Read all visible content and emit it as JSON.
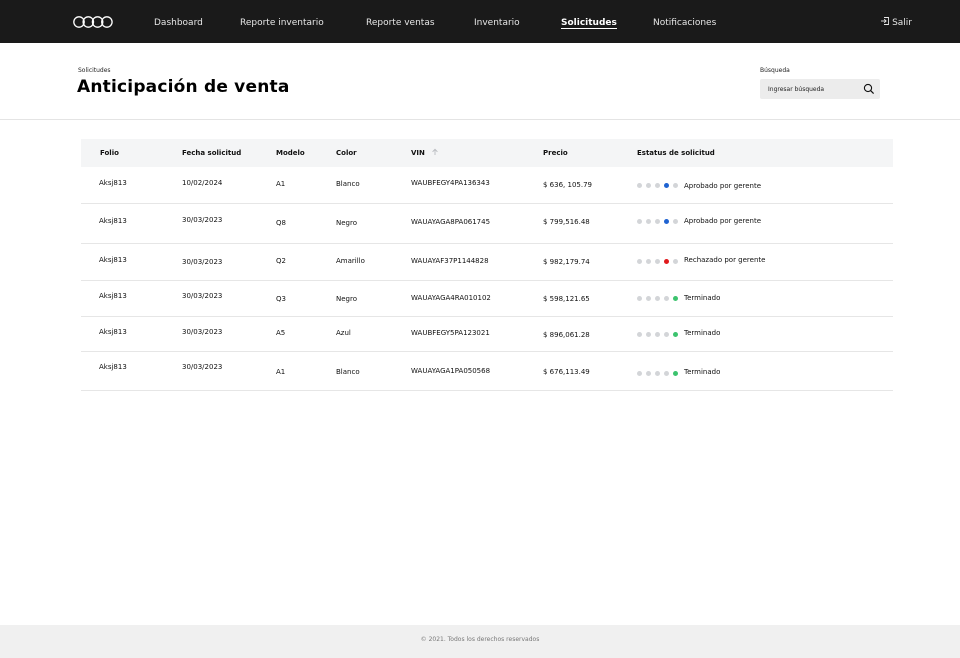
{
  "nav": {
    "items": [
      {
        "label": "Dashboard"
      },
      {
        "label": "Reporte inventario"
      },
      {
        "label": "Reporte ventas"
      },
      {
        "label": "Inventario"
      },
      {
        "label": "Solicitudes"
      },
      {
        "label": "Notificaciones"
      }
    ],
    "active": "Solicitudes",
    "logout_label": "Salir"
  },
  "header": {
    "breadcrumb": "Solicitudes",
    "title": "Anticipación de venta",
    "search_label": "Búsqueda",
    "search_placeholder": "Ingresar búsqueda"
  },
  "table": {
    "columns": [
      "Folio",
      "Fecha solicitud",
      "Modelo",
      "Color",
      "VIN",
      "Precio",
      "Estatus de solicitud"
    ],
    "sorted_column": "VIN",
    "rows": [
      {
        "folio": "Aksj813",
        "fecha": "10/02/2024",
        "modelo": "A1",
        "color": "Blanco",
        "vin": "WAUBFEGY4PA136343",
        "precio": "$ 636, 105.79",
        "estatus": "Aprobado por gerente",
        "step": 4,
        "status_color": "#1f63d1"
      },
      {
        "folio": "Aksj813",
        "fecha": "30/03/2023",
        "modelo": "Q8",
        "color": "Negro",
        "vin": "WAUAYAGA8PA061745",
        "precio": "$ 799,516.48",
        "estatus": "Aprobado por gerente",
        "step": 4,
        "status_color": "#1f63d1"
      },
      {
        "folio": "Aksj813",
        "fecha": "30/03/2023",
        "modelo": "Q2",
        "color": "Amarillo",
        "vin": "WAUAYAF37P1144828",
        "precio": "$ 982,179.74",
        "estatus": "Rechazado por gerente",
        "step": 4,
        "status_color": "#e0191c"
      },
      {
        "folio": "Aksj813",
        "fecha": "30/03/2023",
        "modelo": "Q3",
        "color": "Negro",
        "vin": "WAUAYAGA4RA010102",
        "precio": "$ 598,121.65",
        "estatus": "Terminado",
        "step": 5,
        "status_color": "#3cc36e"
      },
      {
        "folio": "Aksj813",
        "fecha": "30/03/2023",
        "modelo": "A5",
        "color": "Azul",
        "vin": "WAUBFEGY5PA123021",
        "precio": "$ 896,061.28",
        "estatus": "Terminado",
        "step": 5,
        "status_color": "#3cc36e"
      },
      {
        "folio": "Aksj813",
        "fecha": "30/03/2023",
        "modelo": "A1",
        "color": "Blanco",
        "vin": "WAUAYAGA1PA050568",
        "precio": "$ 676,113.49",
        "estatus": "Terminado",
        "step": 5,
        "status_color": "#3cc36e"
      }
    ]
  },
  "colors": {
    "topbar": "#1a1a1a",
    "dot_inactive": "#d3d5d8"
  },
  "icons": {
    "logo": "four-rings-logo-icon",
    "logout": "logout-icon",
    "search": "search-icon",
    "sort": "sort-ascending-icon"
  },
  "footer": {
    "text": "© 2021. Todos los derechos reservados"
  }
}
